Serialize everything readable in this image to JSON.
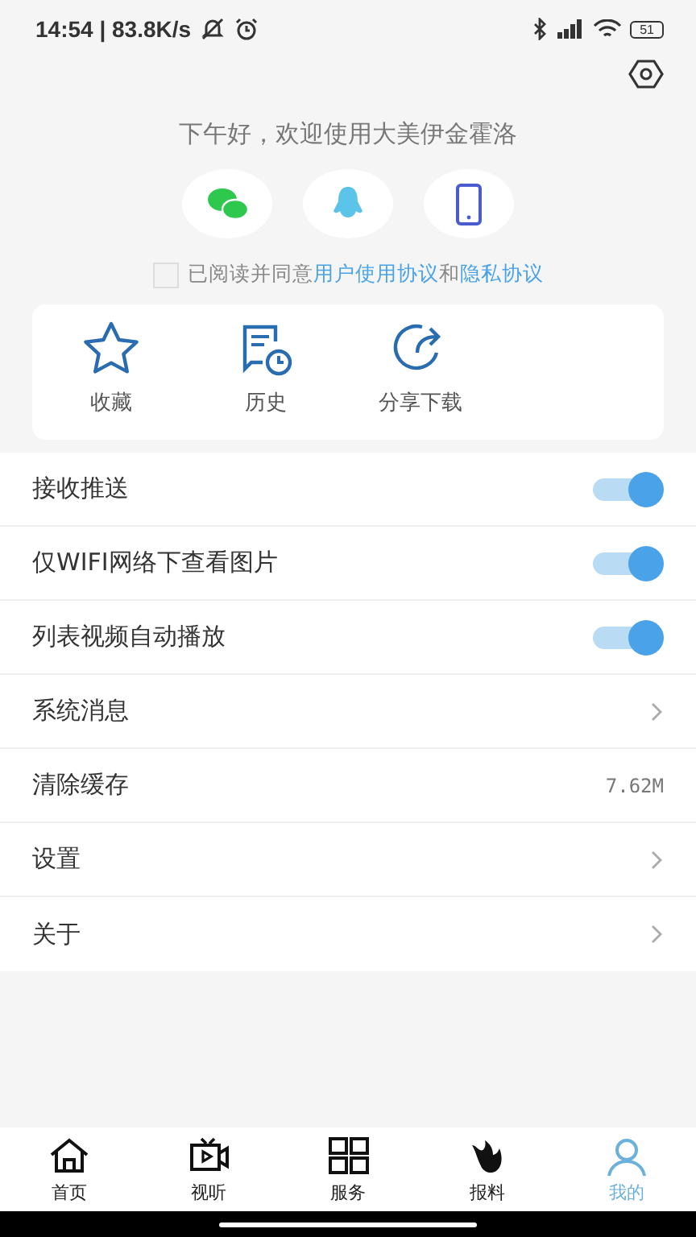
{
  "status_bar": {
    "time": "14:54 | 83.8K/s",
    "battery": "51"
  },
  "greeting": "下午好，欢迎使用大美伊金霍洛",
  "login_options": [
    {
      "kind": "wechat"
    },
    {
      "kind": "qq"
    },
    {
      "kind": "phone"
    }
  ],
  "agreement": {
    "checked": false,
    "text": "已阅读并同意",
    "link_1": "用户使用协议",
    "joiner": "和",
    "link_2": "隐私协议"
  },
  "shortcuts": [
    {
      "kind": "star",
      "label": "收藏"
    },
    {
      "kind": "history",
      "label": "历史"
    },
    {
      "kind": "share",
      "label": "分享下载"
    }
  ],
  "settings": [
    {
      "kind": "toggle",
      "label": "接收推送",
      "on": true
    },
    {
      "kind": "toggle",
      "label": "仅WIFI网络下查看图片",
      "on": true
    },
    {
      "kind": "toggle",
      "label": "列表视频自动播放",
      "on": true
    },
    {
      "kind": "arrow",
      "label": "系统消息"
    },
    {
      "kind": "value",
      "label": "清除缓存",
      "value": "7.62M"
    },
    {
      "kind": "arrow",
      "label": "设置"
    },
    {
      "kind": "arrow",
      "label": "关于"
    }
  ],
  "tab_bar": [
    {
      "kind": "home",
      "label": "首页",
      "selected": false
    },
    {
      "kind": "video",
      "label": "视听",
      "selected": false
    },
    {
      "kind": "grid",
      "label": "服务",
      "selected": false
    },
    {
      "kind": "fire",
      "label": "报料",
      "selected": false
    },
    {
      "kind": "person",
      "label": "我的",
      "selected": true
    }
  ]
}
